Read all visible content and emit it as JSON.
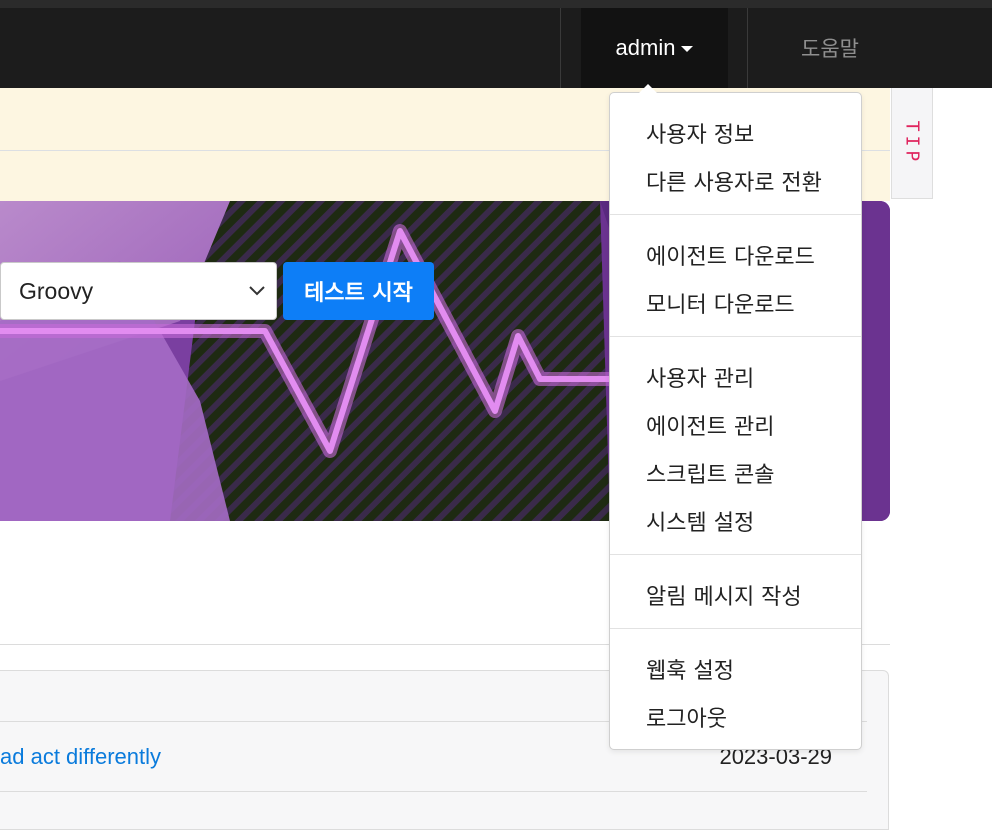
{
  "topbar": {
    "admin_label": "admin",
    "help_label": "도움말"
  },
  "tip": {
    "label": "TIP"
  },
  "test": {
    "script_type": "Groovy",
    "start_label": "테스트 시작"
  },
  "dropdown": {
    "groups": [
      [
        "사용자 정보",
        "다른 사용자로 전환"
      ],
      [
        "에이전트 다운로드",
        "모니터 다운로드"
      ],
      [
        "사용자 관리",
        "에이전트 관리",
        "스크립트 콘솔",
        "시스템 설정"
      ],
      [
        "알림 메시지 작성"
      ],
      [
        "웹훅 설정",
        "로그아웃"
      ]
    ]
  },
  "posts": [
    {
      "title": "ad act differently",
      "date": "2023-03-29"
    }
  ],
  "colors": {
    "topbar": "#1c1c1c",
    "notice": "#fdf6e1",
    "accent": "#0d7ef7",
    "banner": "#7a3fa0",
    "tip": "#e0245e"
  }
}
